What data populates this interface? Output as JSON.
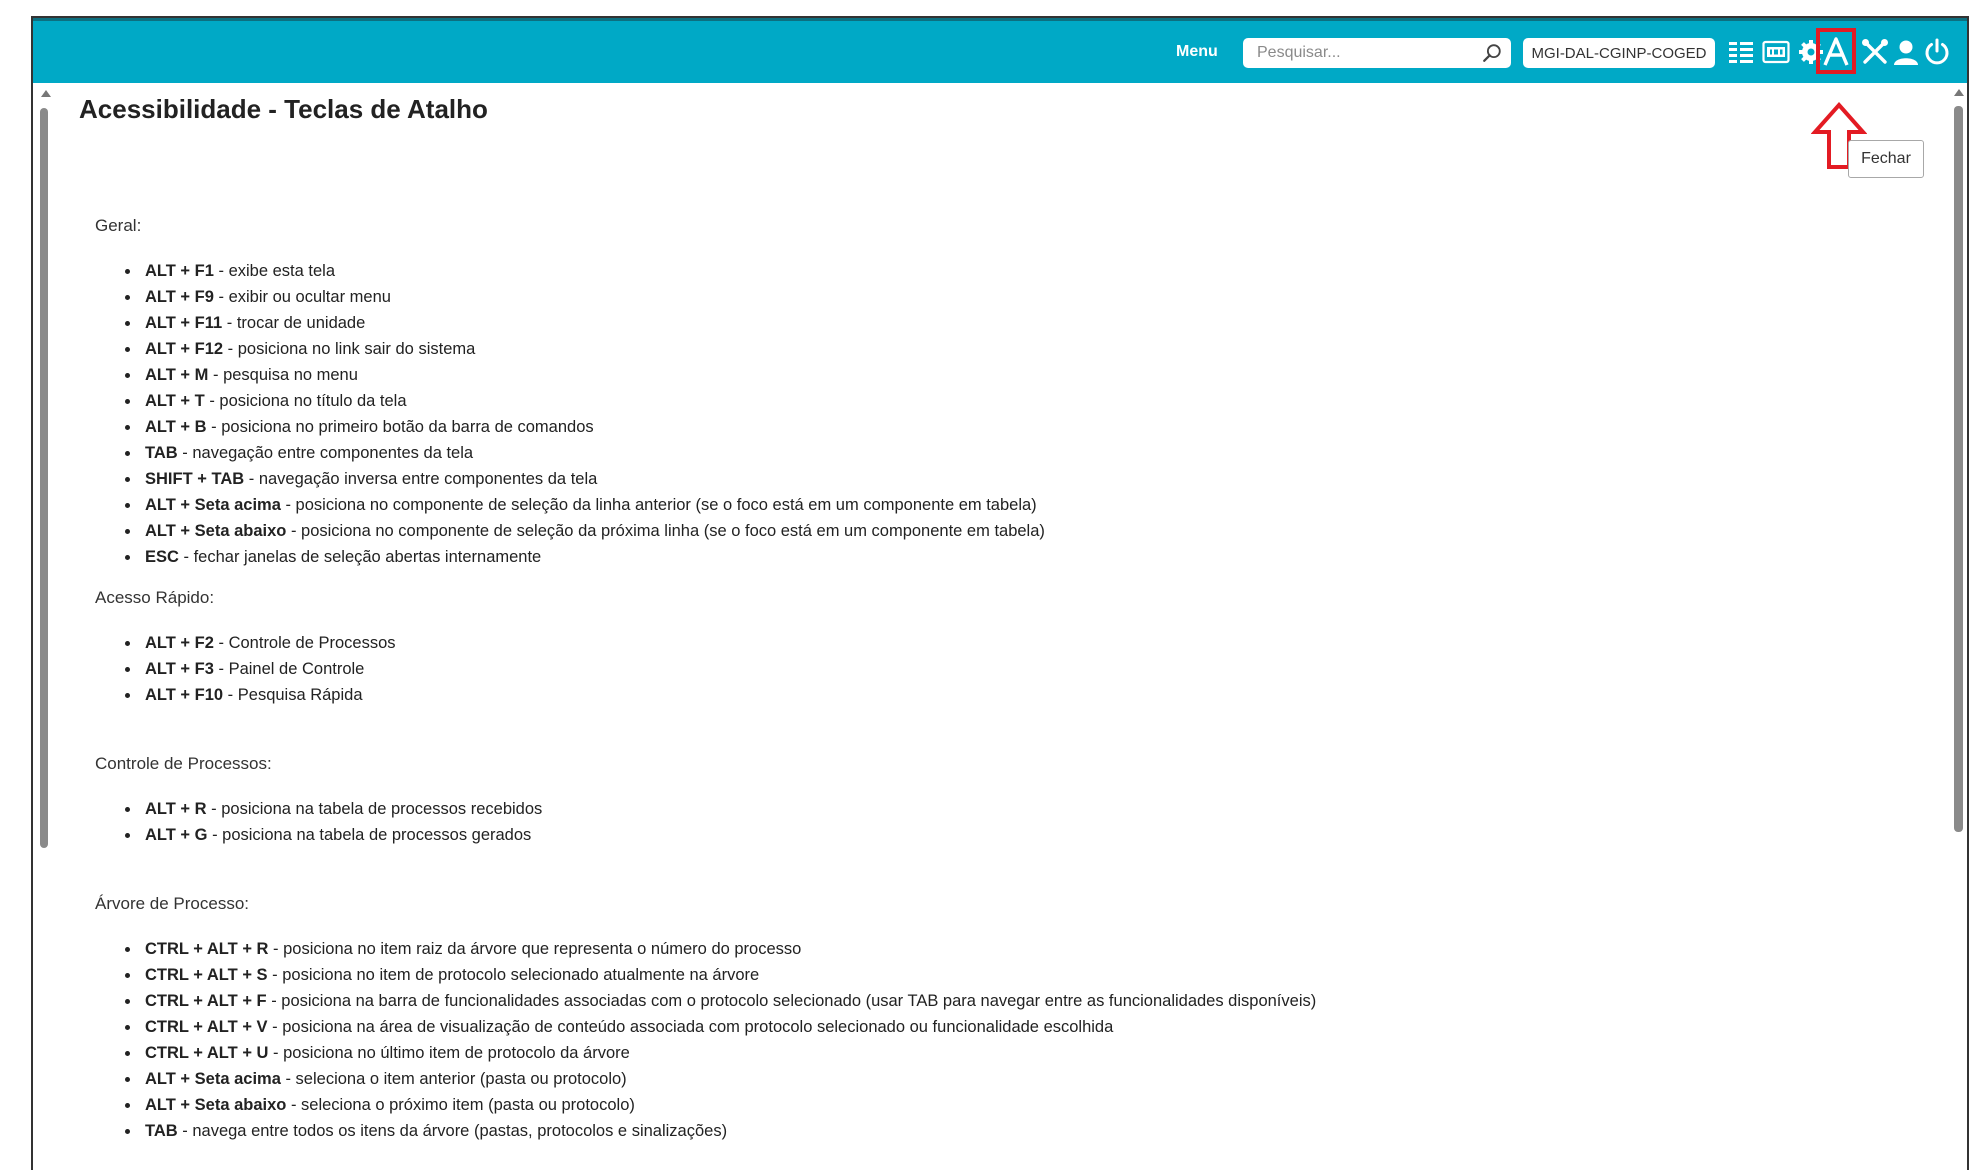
{
  "topbar": {
    "menu_label": "Menu",
    "search_placeholder": "Pesquisar...",
    "unit": "MGI-DAL-CGINP-COGED",
    "icons": [
      "list-icon",
      "numeric-keyboard-icon",
      "gear-icon",
      "accessibility-a-icon",
      "tools-icon",
      "user-icon",
      "power-icon"
    ],
    "accent_color": "#00a9c6",
    "highlight_color": "#e31b23"
  },
  "close_button": "Fechar",
  "page_title": "Acessibilidade - Teclas de Atalho",
  "sections": [
    {
      "title": "Geral:",
      "items": [
        {
          "key": "ALT + F1",
          "desc": " - exibe esta tela"
        },
        {
          "key": "ALT + F9",
          "desc": " - exibir ou ocultar menu"
        },
        {
          "key": "ALT + F11",
          "desc": " - trocar de unidade"
        },
        {
          "key": "ALT + F12",
          "desc": " - posiciona no link sair do sistema"
        },
        {
          "key": "ALT + M",
          "desc": " - pesquisa no menu"
        },
        {
          "key": "ALT + T",
          "desc": " - posiciona no título da tela"
        },
        {
          "key": "ALT + B",
          "desc": " - posiciona no primeiro botão da barra de comandos"
        },
        {
          "key": "TAB",
          "desc": " - navegação entre componentes da tela"
        },
        {
          "key": "SHIFT + TAB",
          "desc": " - navegação inversa entre componentes da tela"
        },
        {
          "key": "ALT + Seta acima",
          "desc": " - posiciona no componente de seleção da linha anterior (se o foco está em um componente em tabela)"
        },
        {
          "key": "ALT + Seta abaixo",
          "desc": " - posiciona no componente de seleção da próxima linha (se o foco está em um componente em tabela)"
        },
        {
          "key": "ESC",
          "desc": " - fechar janelas de seleção abertas internamente"
        }
      ]
    },
    {
      "title": "Acesso Rápido:",
      "items": [
        {
          "key": "ALT + F2",
          "desc": " - Controle de Processos"
        },
        {
          "key": "ALT + F3",
          "desc": " - Painel de Controle"
        },
        {
          "key": "ALT + F10",
          "desc": " - Pesquisa Rápida"
        }
      ]
    },
    {
      "title": "Controle de Processos:",
      "items": [
        {
          "key": "ALT + R",
          "desc": " - posiciona na tabela de processos recebidos"
        },
        {
          "key": "ALT + G",
          "desc": " - posiciona na tabela de processos gerados"
        }
      ]
    },
    {
      "title": "Árvore de Processo:",
      "items": [
        {
          "key": "CTRL + ALT + R",
          "desc": " - posiciona no item raiz da árvore que representa o número do processo"
        },
        {
          "key": "CTRL + ALT + S",
          "desc": " - posiciona no item de protocolo selecionado atualmente na árvore"
        },
        {
          "key": "CTRL + ALT + F",
          "desc": " - posiciona na barra de funcionalidades associadas com o protocolo selecionado (usar TAB para navegar entre as funcionalidades disponíveis)"
        },
        {
          "key": "CTRL + ALT + V",
          "desc": " - posiciona na área de visualização de conteúdo associada com protocolo selecionado ou funcionalidade escolhida"
        },
        {
          "key": "CTRL + ALT + U",
          "desc": " - posiciona no último item de protocolo da árvore"
        },
        {
          "key": "ALT + Seta acima",
          "desc": " - seleciona o item anterior (pasta ou protocolo)"
        },
        {
          "key": "ALT + Seta abaixo",
          "desc": " - seleciona o próximo item (pasta ou protocolo)"
        },
        {
          "key": "TAB",
          "desc": " - navega entre todos os itens da árvore (pastas, protocolos e sinalizações)"
        }
      ]
    }
  ]
}
